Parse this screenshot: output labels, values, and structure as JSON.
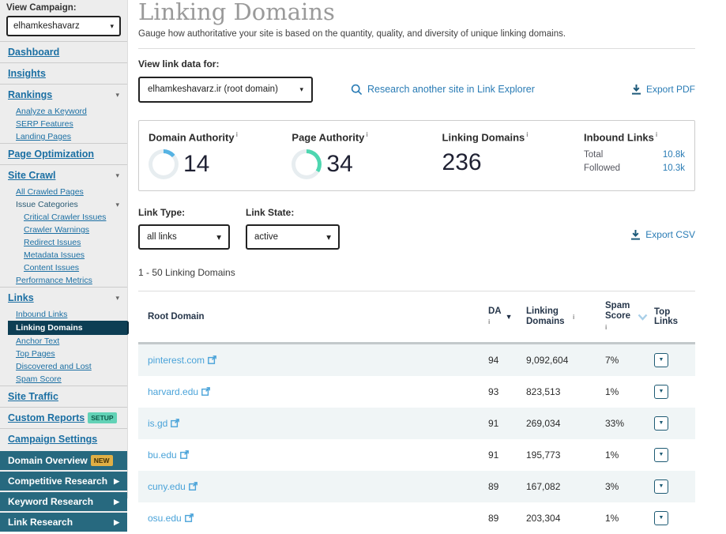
{
  "colors": {
    "accent_blue": "#2a7cb5",
    "sidebar_link_blue": "#1b6fa3",
    "table_link_blue": "#4aa3d9",
    "selected_item_bg": "#0d3e54",
    "dark_item_bg": "#27697f",
    "gauge_da_blue": "#56b3e3",
    "gauge_pa_teal": "#4ed6b0",
    "gauge_track": "#e7edf0",
    "badge_setup_bg": "#62d2b6",
    "badge_new_bg": "#e0af45",
    "row_alt_bg": "#f0f5f6"
  },
  "info_symbol": "i",
  "sidebar": {
    "view_campaign_label": "View Campaign:",
    "campaign_selected": "elhamkeshavarz",
    "dashboard": "Dashboard",
    "insights": "Insights",
    "rankings": "Rankings",
    "rankings_sub": [
      "Analyze a Keyword",
      "SERP Features",
      "Landing Pages"
    ],
    "page_optimization": "Page Optimization",
    "site_crawl": "Site Crawl",
    "all_crawled_pages": "All Crawled Pages",
    "issue_categories": "Issue Categories",
    "issue_sub": [
      "Critical Crawler Issues",
      "Crawler Warnings",
      "Redirect Issues",
      "Metadata Issues",
      "Content Issues"
    ],
    "performance_metrics": "Performance Metrics",
    "links": "Links",
    "inbound_links": "Inbound Links",
    "linking_domains_selected": "Linking Domains",
    "anchor_text": "Anchor Text",
    "top_pages": "Top Pages",
    "discovered_and_lost": "Discovered and Lost",
    "spam_score": "Spam Score",
    "site_traffic": "Site Traffic",
    "custom_reports": "Custom Reports",
    "setup_badge": "SETUP",
    "campaign_settings": "Campaign Settings",
    "domain_overview": "Domain Overview",
    "new_badge": "NEW",
    "competitive_research": "Competitive Research",
    "keyword_research": "Keyword Research",
    "link_research": "Link Research"
  },
  "header": {
    "title": "Linking Domains",
    "subtitle": "Gauge how authoritative your site is based on the quantity, quality, and diversity of unique linking domains."
  },
  "controls": {
    "view_link_data_label": "View link data for:",
    "site_selected": "elhamkeshavarz.ir (root domain)",
    "research_link": "Research another site in Link Explorer",
    "export_pdf": "Export PDF",
    "export_csv": "Export CSV",
    "link_type_label": "Link Type:",
    "link_type_value": "all links",
    "link_state_label": "Link State:",
    "link_state_value": "active",
    "results_count": "1 - 50 Linking Domains"
  },
  "metrics": {
    "domain_authority": {
      "label": "Domain Authority",
      "value": "14"
    },
    "page_authority": {
      "label": "Page Authority",
      "value": "34"
    },
    "linking_domains": {
      "label": "Linking Domains",
      "value": "236"
    },
    "inbound_links": {
      "label": "Inbound Links",
      "total_label": "Total",
      "total_value": "10.8k",
      "followed_label": "Followed",
      "followed_value": "10.3k"
    }
  },
  "table": {
    "headers": {
      "root_domain": "Root Domain",
      "da": "DA",
      "linking_domains": "Linking Domains",
      "spam_score": "Spam Score",
      "top_links": "Top Links"
    },
    "rows": [
      {
        "domain": "pinterest.com",
        "da": "94",
        "linking_domains": "9,092,604",
        "spam": "7%"
      },
      {
        "domain": "harvard.edu",
        "da": "93",
        "linking_domains": "823,513",
        "spam": "1%"
      },
      {
        "domain": "is.gd",
        "da": "91",
        "linking_domains": "269,034",
        "spam": "33%"
      },
      {
        "domain": "bu.edu",
        "da": "91",
        "linking_domains": "195,773",
        "spam": "1%"
      },
      {
        "domain": "cuny.edu",
        "da": "89",
        "linking_domains": "167,082",
        "spam": "3%"
      },
      {
        "domain": "osu.edu",
        "da": "89",
        "linking_domains": "203,304",
        "spam": "1%"
      }
    ]
  }
}
